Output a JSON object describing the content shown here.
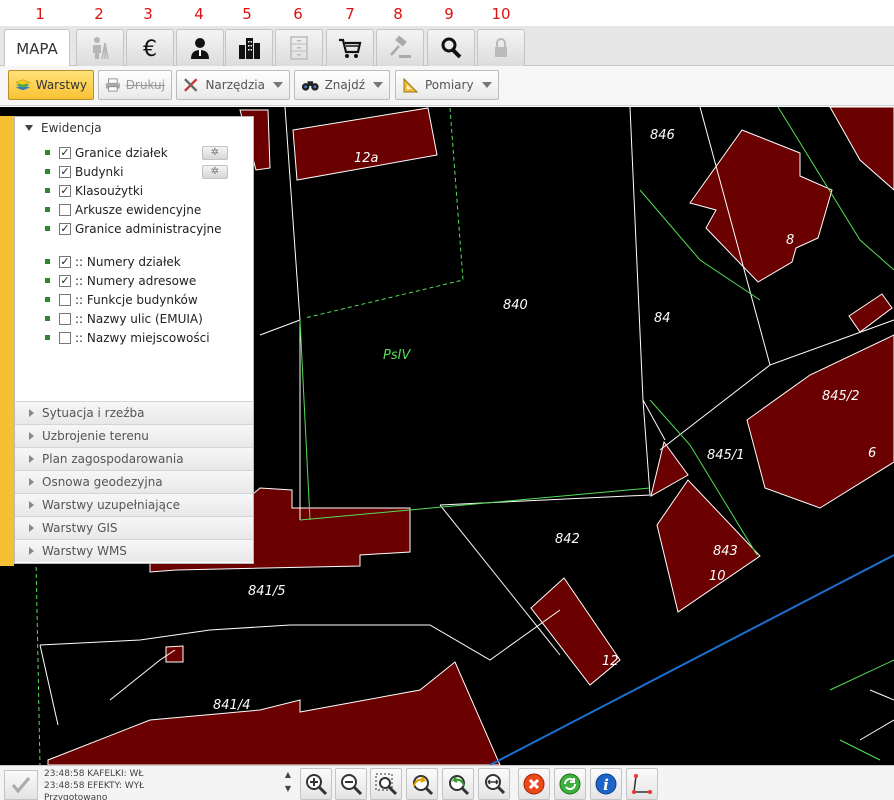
{
  "tab_numbers": [
    "1",
    "2",
    "3",
    "4",
    "5",
    "6",
    "7",
    "8",
    "9",
    "10"
  ],
  "tabs": {
    "mapa_label": "MAPA",
    "icons": [
      "surveyor-icon",
      "euro-icon",
      "person-icon",
      "buildings-icon",
      "file-cabinet-icon",
      "cart-icon",
      "gavel-icon",
      "magnifier-icon",
      "lock-icon"
    ]
  },
  "toolbar": {
    "layers_label": "Warstwy",
    "print_label": "Drukuj",
    "tools_label": "Narzędzia",
    "find_label": "Znajdź",
    "measure_label": "Pomiary"
  },
  "panel": {
    "section_title": "Ewidencja",
    "layers": [
      {
        "label": "Granice działek",
        "checked": true
      },
      {
        "label": "Budynki",
        "checked": true
      },
      {
        "label": "Klasoużytki",
        "checked": true
      },
      {
        "label": "Arkusze ewidencyjne",
        "checked": false
      },
      {
        "label": "Granice administracyjne",
        "checked": true
      }
    ],
    "labels": [
      {
        "label": ":: Numery działek",
        "checked": true
      },
      {
        "label": ":: Numery adresowe",
        "checked": true
      },
      {
        "label": ":: Funkcje budynków",
        "checked": false
      },
      {
        "label": ":: Nazwy ulic (EMUIA)",
        "checked": false
      },
      {
        "label": ":: Nazwy miejscowości",
        "checked": false
      }
    ],
    "collapsed_sections": [
      "Sytuacja i rzeźba",
      "Uzbrojenie terenu",
      "Plan zagospodarowania",
      "Osnowa geodezyjna",
      "Warstwy uzupełniające",
      "Warstwy GIS",
      "Warstwy WMS"
    ]
  },
  "map": {
    "labels": [
      "12a",
      "846",
      "8",
      "840",
      "84",
      "PsIV",
      "845/2",
      "845/1",
      "6",
      "842",
      "843",
      "10",
      "841/5",
      "12",
      "841/4"
    ],
    "colors": {
      "background": "#000000",
      "building": "#6b0000",
      "parcel_line": "#ffffff",
      "green_line": "#55dd55",
      "blue_line": "#1a6fd0"
    }
  },
  "status": {
    "log": [
      "23:48:58 KAFELKI: WŁ",
      "23:48:58 EFEKTY: WYŁ",
      "Przygotowano"
    ]
  },
  "map_tools": [
    "zoom-in-icon",
    "zoom-out-icon",
    "zoom-window-icon",
    "zoom-previous-icon",
    "zoom-next-icon",
    "zoom-extent-icon",
    "close-red-icon",
    "refresh-green-icon",
    "info-icon",
    "measure-angle-icon"
  ]
}
